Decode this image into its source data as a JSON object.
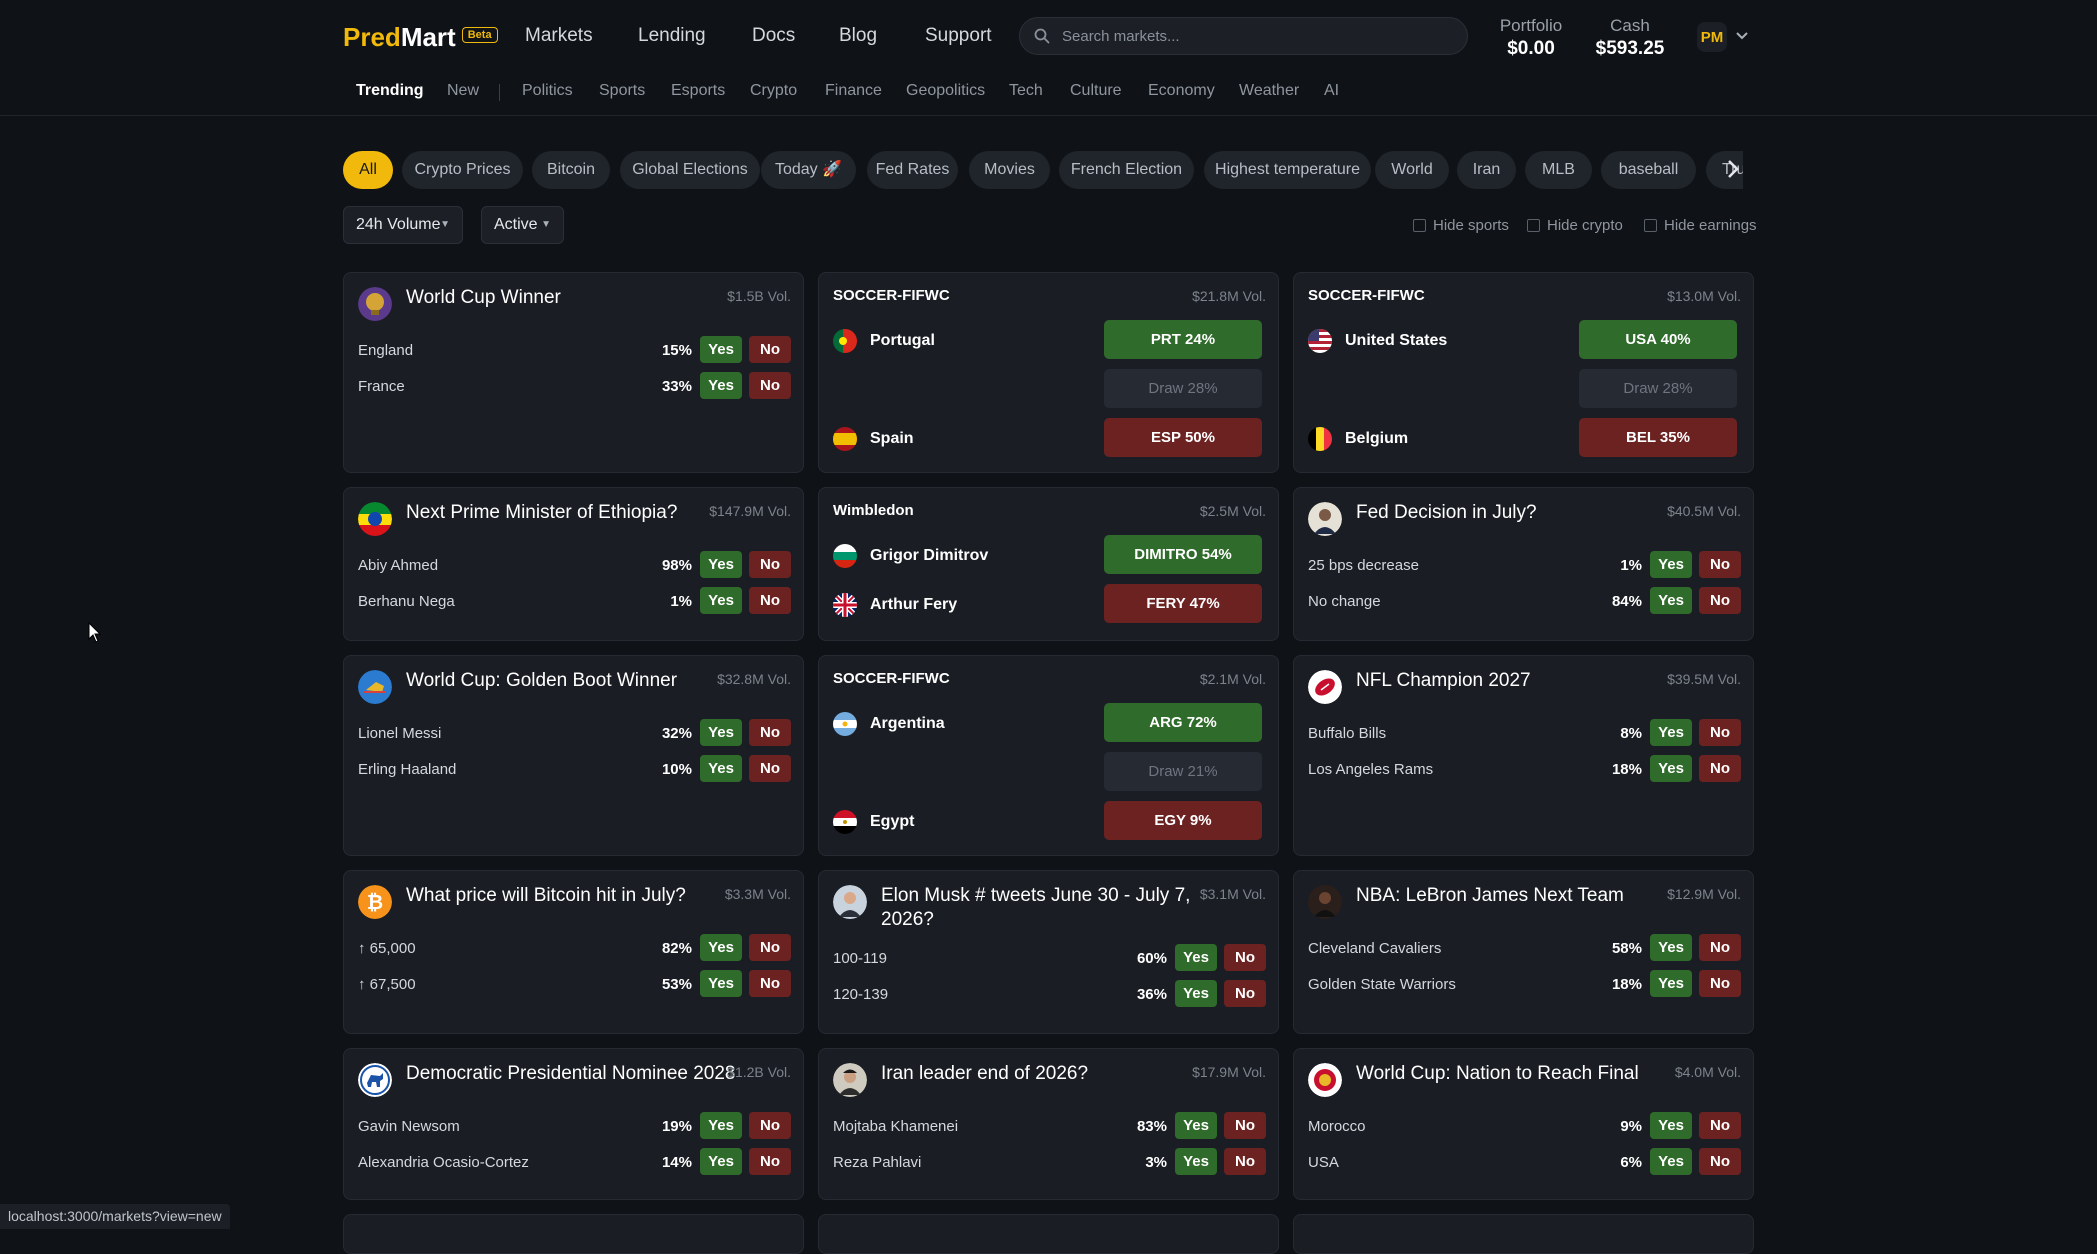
{
  "header": {
    "logo_pred": "Pred",
    "logo_mart": "Mart",
    "beta": "Beta",
    "nav": [
      "Markets",
      "Lending",
      "Docs",
      "Blog",
      "Support"
    ],
    "search_placeholder": "Search markets...",
    "portfolio_label": "Portfolio",
    "portfolio_value": "$0.00",
    "cash_label": "Cash",
    "cash_value": "$593.25",
    "avatar": "PM"
  },
  "categories": [
    "Trending",
    "New",
    "Politics",
    "Sports",
    "Esports",
    "Crypto",
    "Finance",
    "Geopolitics",
    "Tech",
    "Culture",
    "Economy",
    "Weather",
    "AI"
  ],
  "chips": [
    "All",
    "Crypto Prices",
    "Bitcoin",
    "Global Elections",
    "Today 🚀",
    "Fed Rates",
    "Movies",
    "French Election",
    "Highest temperature",
    "World",
    "Iran",
    "MLB",
    "baseball",
    "Trump"
  ],
  "filters": {
    "sort": "24h Volume",
    "status": "Active",
    "hide_sports": "Hide sports",
    "hide_crypto": "Hide crypto",
    "hide_earnings": "Hide earnings"
  },
  "labels": {
    "yes": "Yes",
    "no": "No"
  },
  "colors": {
    "accent": "#f0b90b",
    "yes": "#2f6b2a",
    "no": "#6d2222",
    "background": "#0f1216",
    "card": "#1a1e24"
  },
  "markets": {
    "m1": {
      "title": "World Cup Winner",
      "vol": "$1.5B Vol.",
      "icon": "trophy-icon",
      "rows": [
        {
          "name": "England",
          "pct": "15%"
        },
        {
          "name": "France",
          "pct": "33%"
        }
      ]
    },
    "m2": {
      "league": "SOCCER-FIFWC",
      "vol": "$21.8M Vol.",
      "team_a": "Portugal",
      "team_b": "Spain",
      "btn_a": "PRT 24%",
      "draw": "Draw 28%",
      "btn_b": "ESP 50%"
    },
    "m3": {
      "league": "SOCCER-FIFWC",
      "vol": "$13.0M Vol.",
      "team_a": "United States",
      "team_b": "Belgium",
      "btn_a": "USA 40%",
      "draw": "Draw 28%",
      "btn_b": "BEL 35%"
    },
    "m4": {
      "title": "Next Prime Minister of Ethiopia?",
      "vol": "$147.9M Vol.",
      "icon": "ethiopia-flag-icon",
      "rows": [
        {
          "name": "Abiy Ahmed",
          "pct": "98%"
        },
        {
          "name": "Berhanu Nega",
          "pct": "1%"
        }
      ]
    },
    "m5": {
      "league": "Wimbledon",
      "vol": "$2.5M Vol.",
      "team_a": "Grigor Dimitrov",
      "team_b": "Arthur Fery",
      "btn_a": "DIMITRO 54%",
      "btn_b": "FERY 47%"
    },
    "m6": {
      "title": "Fed Decision in July?",
      "vol": "$40.5M Vol.",
      "icon": "fed-chair-icon",
      "rows": [
        {
          "name": "25 bps decrease",
          "pct": "1%"
        },
        {
          "name": "No change",
          "pct": "84%"
        }
      ]
    },
    "m7": {
      "title": "World Cup: Golden Boot Winner",
      "vol": "$32.8M Vol.",
      "icon": "golden-boot-icon",
      "rows": [
        {
          "name": "Lionel Messi",
          "pct": "32%"
        },
        {
          "name": "Erling Haaland",
          "pct": "10%"
        }
      ]
    },
    "m8": {
      "league": "SOCCER-FIFWC",
      "vol": "$2.1M Vol.",
      "team_a": "Argentina",
      "team_b": "Egypt",
      "btn_a": "ARG 72%",
      "draw": "Draw 21%",
      "btn_b": "EGY 9%"
    },
    "m9": {
      "title": "NFL Champion 2027",
      "vol": "$39.5M Vol.",
      "icon": "football-icon",
      "rows": [
        {
          "name": "Buffalo Bills",
          "pct": "8%"
        },
        {
          "name": "Los Angeles Rams",
          "pct": "18%"
        }
      ]
    },
    "m10": {
      "title": "What price will Bitcoin hit in July?",
      "vol": "$3.3M Vol.",
      "icon": "bitcoin-icon",
      "rows": [
        {
          "name": "↑ 65,000",
          "pct": "82%"
        },
        {
          "name": "↑ 67,500",
          "pct": "53%"
        }
      ]
    },
    "m11": {
      "title_line1": "Elon Musk # tweets June 30 - July 7,",
      "title_line2": "2026?",
      "vol": "$3.1M Vol.",
      "icon": "elon-musk-avatar-icon",
      "rows": [
        {
          "name": "100-119",
          "pct": "60%"
        },
        {
          "name": "120-139",
          "pct": "36%"
        }
      ]
    },
    "m12": {
      "title": "NBA: LeBron James Next Team",
      "vol": "$12.9M Vol.",
      "icon": "lebron-avatar-icon",
      "rows": [
        {
          "name": "Cleveland Cavaliers",
          "pct": "58%"
        },
        {
          "name": "Golden State Warriors",
          "pct": "18%"
        }
      ]
    },
    "m13": {
      "title": "Democratic Presidential Nominee 2028",
      "vol": "$1.2B Vol.",
      "icon": "democrat-donkey-icon",
      "rows": [
        {
          "name": "Gavin Newsom",
          "pct": "19%"
        },
        {
          "name": "Alexandria Ocasio-Cortez",
          "pct": "14%"
        }
      ]
    },
    "m14": {
      "title": "Iran leader end of 2026?",
      "vol": "$17.9M Vol.",
      "icon": "iran-leader-avatar-icon",
      "rows": [
        {
          "name": "Mojtaba Khamenei",
          "pct": "83%"
        },
        {
          "name": "Reza Pahlavi",
          "pct": "3%"
        }
      ]
    },
    "m15": {
      "title": "World Cup: Nation to Reach Final",
      "vol": "$4.0M Vol.",
      "icon": "world-cup-badge-icon",
      "rows": [
        {
          "name": "Morocco",
          "pct": "9%"
        },
        {
          "name": "USA",
          "pct": "6%"
        }
      ]
    }
  },
  "status_url": "localhost:3000/markets?view=new"
}
